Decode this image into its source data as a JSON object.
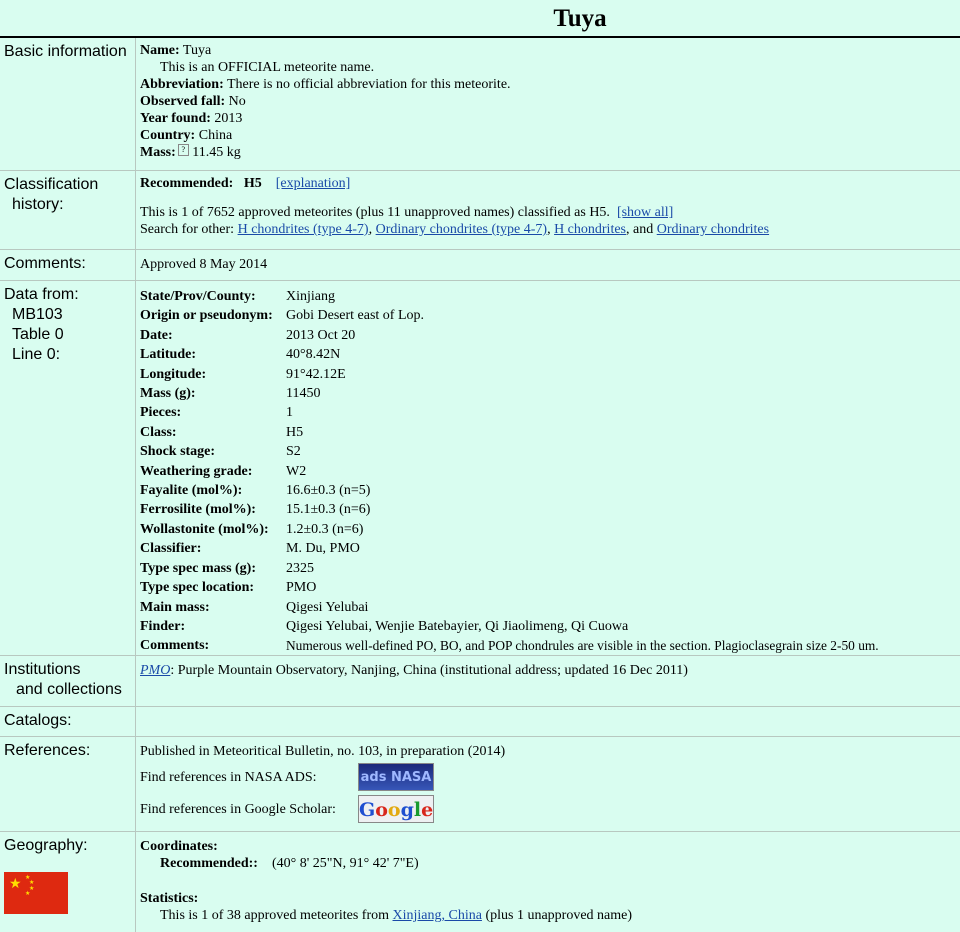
{
  "title": "Tuya",
  "basic": {
    "label": "Basic information",
    "name_key": "Name:",
    "name_val": "Tuya",
    "official": "This is an OFFICIAL meteorite name.",
    "abbr_key": "Abbreviation:",
    "abbr_val": "There is no official abbreviation for this meteorite.",
    "fall_key": "Observed fall:",
    "fall_val": "No",
    "year_key": "Year found:",
    "year_val": "2013",
    "country_key": "Country:",
    "country_val": "China",
    "mass_key": "Mass:",
    "mass_help": "?",
    "mass_val": "11.45 kg"
  },
  "classification": {
    "label1": "Classification",
    "label2": "history:",
    "rec_key": "Recommended:",
    "rec_val": "H5",
    "explanation": "[explanation]",
    "count_text": "This is 1 of 7652 approved meteorites (plus 11 unapproved names) classified as H5.",
    "show_all": "[show all]",
    "search_prefix": "Search for other:",
    "links": [
      "H chondrites (type 4-7)",
      "Ordinary chondrites (type 4-7)",
      "H chondrites",
      "Ordinary chondrites"
    ],
    "sep1": ",",
    "sep2": ",",
    "sep3": ", and"
  },
  "comments": {
    "label": "Comments:",
    "value": "Approved 8 May 2014"
  },
  "datafrom": {
    "label": [
      "Data from:",
      "MB103",
      "Table 0",
      "Line 0:"
    ],
    "fields": [
      {
        "k": "State/Prov/County:",
        "v": "Xinjiang"
      },
      {
        "k": "Origin or pseudonym:",
        "v": "Gobi Desert east of Lop."
      },
      {
        "k": "Date:",
        "v": "2013 Oct 20"
      },
      {
        "k": "Latitude:",
        "v": "40°8.42N"
      },
      {
        "k": "Longitude:",
        "v": "91°42.12E"
      },
      {
        "k": "Mass (g):",
        "v": "11450"
      },
      {
        "k": "Pieces:",
        "v": "1"
      },
      {
        "k": "Class:",
        "v": "H5"
      },
      {
        "k": "Shock stage:",
        "v": "S2"
      },
      {
        "k": "Weathering grade:",
        "v": "W2"
      },
      {
        "k": "Fayalite (mol%):",
        "v": "16.6±0.3 (n=5)"
      },
      {
        "k": "Ferrosilite (mol%):",
        "v": "15.1±0.3 (n=6)"
      },
      {
        "k": "Wollastonite (mol%):",
        "v": "1.2±0.3 (n=6)"
      },
      {
        "k": "Classifier:",
        "v": "M. Du, PMO"
      },
      {
        "k": "Type spec mass (g):",
        "v": "2325"
      },
      {
        "k": "Type spec location:",
        "v": "PMO"
      },
      {
        "k": "Main mass:",
        "v": "Qigesi Yelubai"
      },
      {
        "k": "Finder:",
        "v": "Qigesi Yelubai, Wenjie Batebayier, Qi Jiaolimeng, Qi Cuowa"
      },
      {
        "k": "Comments:",
        "v": "Numerous well-defined PO, BO, and POP chondrules are visible in the section. Plagioclasegrain size 2-50 um."
      }
    ]
  },
  "institutions": {
    "label1": "Institutions",
    "label2": "and collections",
    "link": "PMO",
    "text": ": Purple Mountain Observatory, Nanjing, China (institutional address; updated 16 Dec 2011)"
  },
  "catalogs": {
    "label": "Catalogs:"
  },
  "references": {
    "label": "References:",
    "published": "Published in Meteoritical Bulletin, no. 103, in preparation (2014)",
    "nasa_text": "Find references in NASA ADS:",
    "nasa_badge": "ads NASA",
    "scholar_text": "Find references in Google Scholar:",
    "google_letters": [
      "G",
      "o",
      "o",
      "g",
      "l",
      "e"
    ]
  },
  "geography": {
    "label": "Geography:",
    "coords_key": "Coordinates:",
    "rec_key": "Recommended::",
    "rec_val": "(40° 8' 25\"N, 91° 42' 7\"E)",
    "stats_key": "Statistics:",
    "stats_prefix": "This is 1 of 38 approved meteorites from",
    "stats_link": "Xinjiang, China",
    "stats_suffix": "(plus 1 unapproved name)",
    "flag_icon": "china-flag-icon"
  }
}
